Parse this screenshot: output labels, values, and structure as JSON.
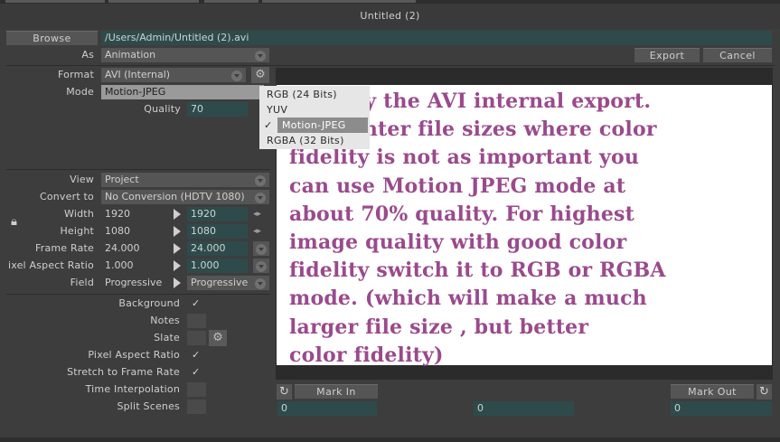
{
  "window": {
    "title": "Untitled (2)"
  },
  "path": {
    "browse_label": "Browse",
    "value": "/Users/Admin/Untitled (2).avi"
  },
  "as": {
    "label": "As",
    "value": "Animation"
  },
  "actions": {
    "export_label": "Export",
    "cancel_label": "Cancel"
  },
  "format": {
    "label": "Format",
    "value": "AVI (Internal)"
  },
  "mode": {
    "label": "Mode",
    "value": "Motion-JPEG",
    "options": [
      "RGB (24 Bits)",
      "YUV",
      "Motion-JPEG",
      "RGBA (32 Bits)"
    ],
    "check_glyph": "✓"
  },
  "quality": {
    "label": "Quality",
    "value": "70"
  },
  "settings": {
    "view": {
      "label": "View",
      "value": "Project"
    },
    "convert": {
      "label": "Convert to",
      "value": "No Conversion (HDTV 1080)"
    },
    "width": {
      "label": "Width",
      "source": "1920",
      "target": "1920"
    },
    "height": {
      "label": "Height",
      "source": "1080",
      "target": "1080"
    },
    "frame_rate": {
      "label": "Frame Rate",
      "source": "24.000",
      "target": "24.000"
    },
    "pixel_aspect": {
      "label": "ixel Aspect Ratio",
      "source": "1.000",
      "target": "1.000"
    },
    "field": {
      "label": "Field",
      "source": "Progressive",
      "target": "Progressive"
    }
  },
  "options": {
    "background": {
      "label": "Background",
      "checked": true,
      "glyph": "✓"
    },
    "notes": {
      "label": "Notes",
      "checked": false
    },
    "slate": {
      "label": "Slate",
      "checked": false
    },
    "pixel_aspect_ratio": {
      "label": "Pixel Aspect Ratio",
      "checked": true,
      "glyph": "✓"
    },
    "stretch": {
      "label": "Stretch to Frame Rate",
      "checked": true,
      "glyph": "✓"
    },
    "time_interp": {
      "label": "Time Interpolation",
      "checked": false
    },
    "split": {
      "label": "Split Scenes",
      "checked": false
    }
  },
  "marks": {
    "mark_in_label": "Mark In",
    "mark_out_label": "Mark Out",
    "in_value": "0",
    "mid_value": "0",
    "out_value": "0"
  },
  "annotation": {
    "lines": [
      "Also try the AVI internal export.",
      "For lighter file sizes where color",
      "fidelity is not as important you",
      "can use Motion JPEG mode at",
      "about 70% quality. For highest",
      "image quality with good color",
      "fidelity switch it to RGB or RGBA",
      "mode. (which will make a much",
      "larger file size , but better",
      "color fidelity)"
    ],
    "text_color": "#9a4a8c"
  },
  "colors": {
    "field_bg": "#2f4a4a",
    "panel_bg": "#3d3d3d",
    "button_bg": "#555555"
  }
}
